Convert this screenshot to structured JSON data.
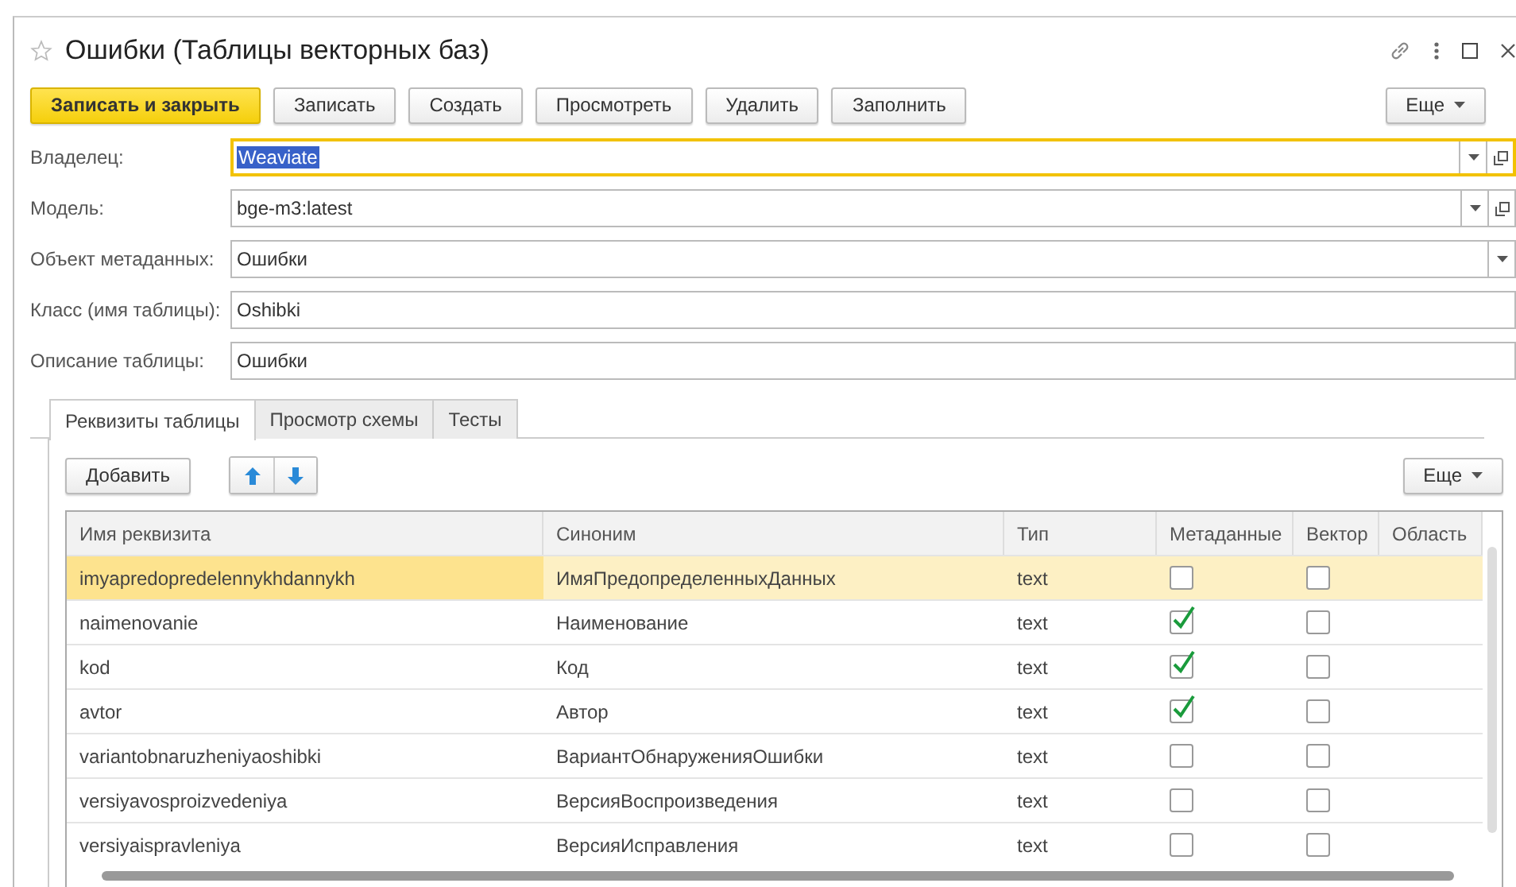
{
  "window": {
    "title": "Ошибки (Таблицы векторных баз)",
    "favorite": false
  },
  "toolbar": [
    {
      "label": "Записать и закрыть",
      "kind": "primary"
    },
    {
      "label": "Записать",
      "kind": "normal"
    },
    {
      "label": "Создать",
      "kind": "normal"
    },
    {
      "label": "Просмотреть",
      "kind": "normal"
    },
    {
      "label": "Удалить",
      "kind": "normal"
    },
    {
      "label": "Заполнить",
      "kind": "normal"
    },
    {
      "label": "Еще",
      "kind": "more"
    }
  ],
  "fields": [
    {
      "label": "Владелец:",
      "value": "Weaviate",
      "focused": true,
      "dropdown": true,
      "open": true
    },
    {
      "label": "Модель:",
      "value": "bge-m3:latest",
      "focused": false,
      "dropdown": true,
      "open": true
    },
    {
      "label": "Объект метаданных:",
      "value": "Ошибки",
      "focused": false,
      "dropdown": true
    },
    {
      "label": "Класс (имя таблицы):",
      "value": "Oshibki",
      "focused": false
    },
    {
      "label": "Описание таблицы:",
      "value": "Ошибки",
      "focused": false
    }
  ],
  "tabs": [
    {
      "label": "Реквизиты таблицы",
      "selected": true
    },
    {
      "label": "Просмотр схемы",
      "selected": false
    },
    {
      "label": "Тесты",
      "selected": false
    }
  ],
  "table_toolbar": {
    "add": "Добавить",
    "more": "Еще"
  },
  "table": {
    "columns": [
      "Имя реквизита",
      "Синоним",
      "Тип",
      "Метаданные",
      "Вектор",
      "Область"
    ],
    "rows": [
      {
        "name": "imyapredopredelennykhdannykh",
        "synonym": "ИмяПредопределенныхДанных",
        "type": "text",
        "metadata": false,
        "vector": false,
        "selected": true
      },
      {
        "name": "naimenovanie",
        "synonym": "Наименование",
        "type": "text",
        "metadata": true,
        "vector": false,
        "selected": false
      },
      {
        "name": "kod",
        "synonym": "Код",
        "type": "text",
        "metadata": true,
        "vector": false,
        "selected": false
      },
      {
        "name": "avtor",
        "synonym": "Автор",
        "type": "text",
        "metadata": true,
        "vector": false,
        "selected": false
      },
      {
        "name": "variantobnaruzheniyaoshibki",
        "synonym": "ВариантОбнаруженияОшибки",
        "type": "text",
        "metadata": false,
        "vector": false,
        "selected": false
      },
      {
        "name": "versiyavosproizvedeniya",
        "synonym": "ВерсияВоспроизведения",
        "type": "text",
        "metadata": false,
        "vector": false,
        "selected": false
      },
      {
        "name": "versiyaispravleniya",
        "synonym": "ВерсияИсправления",
        "type": "text",
        "metadata": false,
        "vector": false,
        "selected": false
      }
    ]
  }
}
